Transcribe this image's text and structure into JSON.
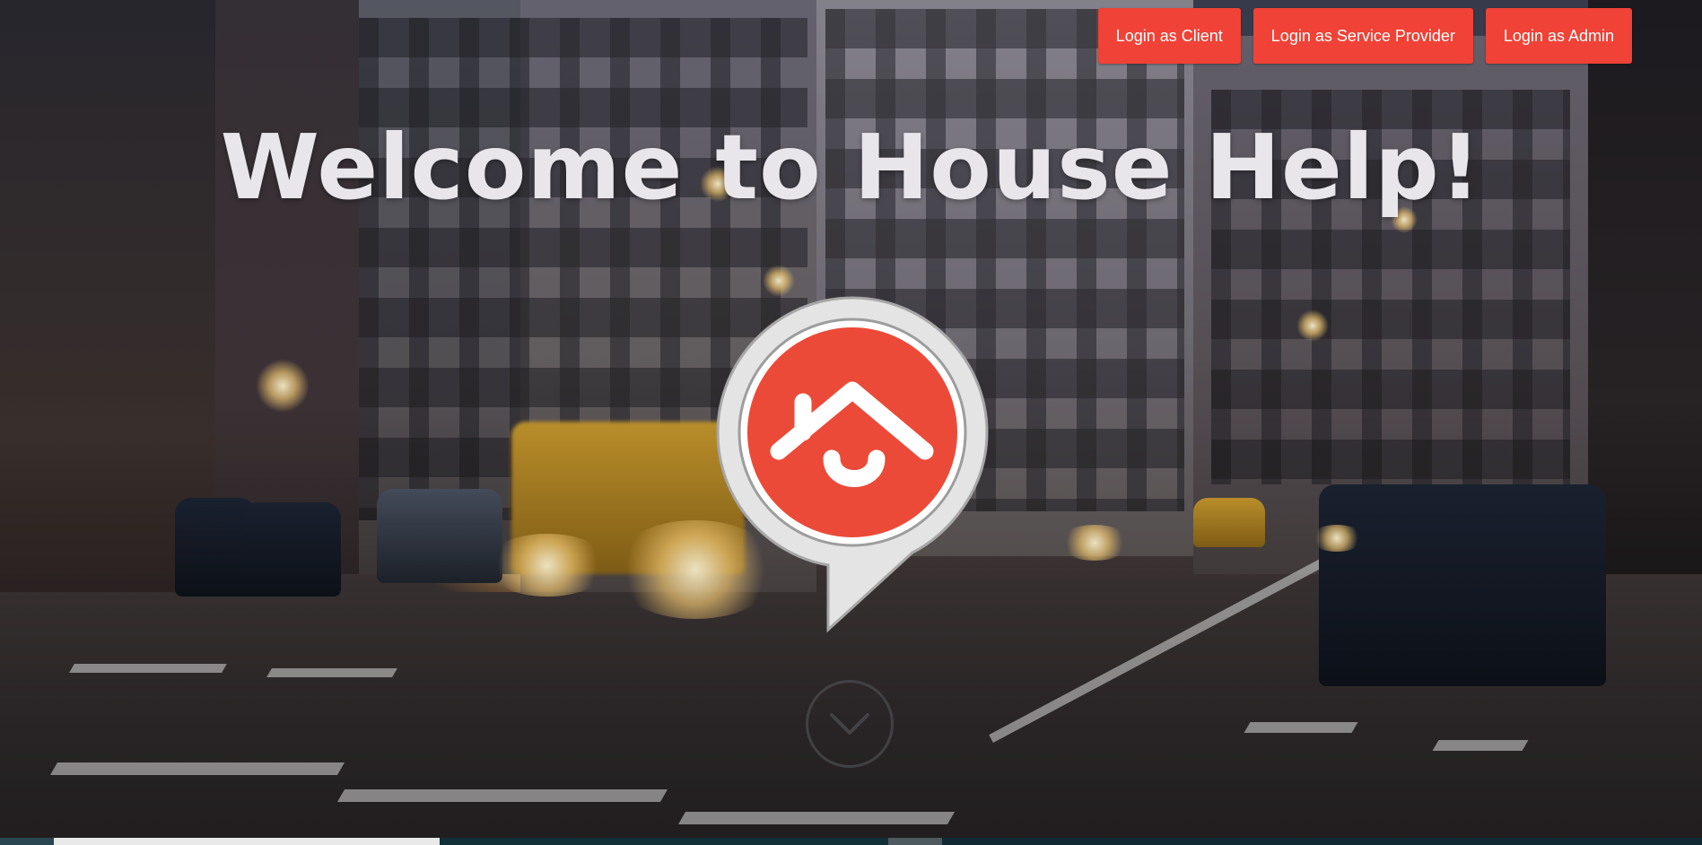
{
  "header": {
    "login_buttons": [
      {
        "label": "Login as Client"
      },
      {
        "label": "Login as Service Provider"
      },
      {
        "label": "Login as Admin"
      }
    ]
  },
  "hero": {
    "title": "Welcome to House Help!",
    "logo_icon": "house-smile-logo-icon",
    "scroll_icon": "chevron-down-circle-icon"
  },
  "colors": {
    "accent": "#f04236",
    "logo_red": "#ec4a38",
    "title": "#e8e6ea",
    "bubble": "#e6e6e6"
  }
}
